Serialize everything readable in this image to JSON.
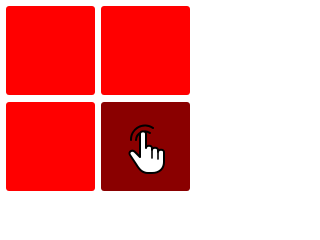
{
  "colors": {
    "tile_default": "#ff0000",
    "tile_pressed": "#8a0000",
    "background": "#ffffff"
  },
  "tiles": [
    {
      "id": "top-left",
      "state": "default"
    },
    {
      "id": "top-right",
      "state": "default"
    },
    {
      "id": "bottom-left",
      "state": "default"
    },
    {
      "id": "bottom-right",
      "state": "pressed"
    }
  ],
  "pointer": {
    "icon": "hand-pointer-click-icon",
    "over_tile": "bottom-right"
  }
}
